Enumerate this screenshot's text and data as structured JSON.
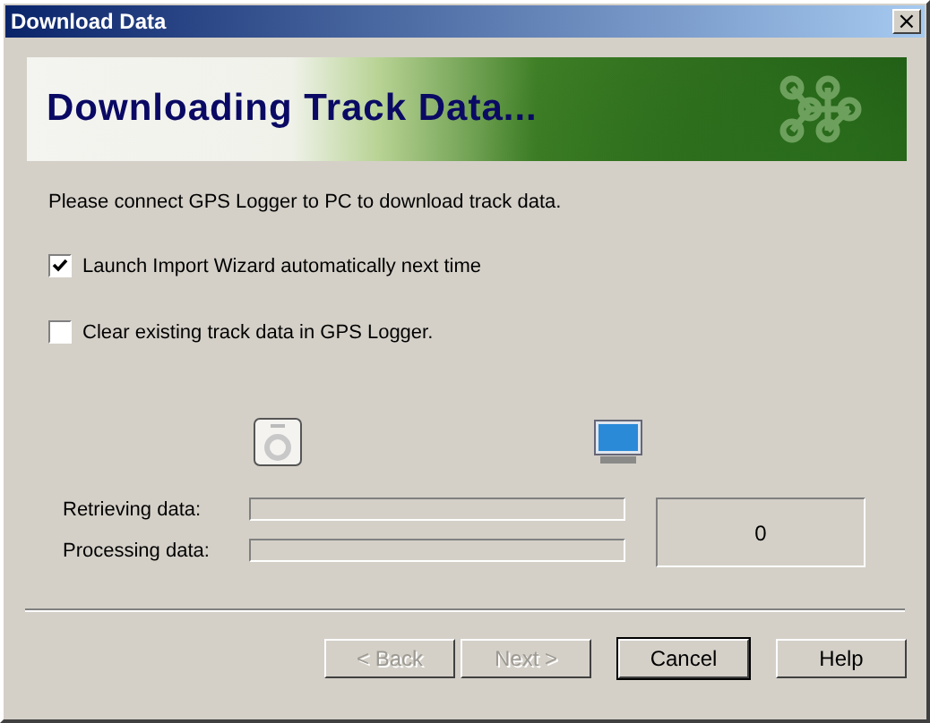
{
  "window": {
    "title": "Download Data",
    "close": "×"
  },
  "banner": {
    "title": "Downloading Track Data..."
  },
  "instruction": "Please connect GPS Logger to PC to download track data.",
  "options": [
    {
      "label": "Launch Import Wizard automatically next time",
      "checked": true
    },
    {
      "label": "Clear existing track data in GPS Logger.",
      "checked": false
    }
  ],
  "progress": [
    {
      "label": "Retrieving data:"
    },
    {
      "label": "Processing data:"
    }
  ],
  "count": "0",
  "buttons": [
    {
      "label": "< Back",
      "disabled": true,
      "default": false
    },
    {
      "label": "Next >",
      "disabled": true,
      "default": false
    },
    {
      "label": "Cancel",
      "disabled": false,
      "default": true
    },
    {
      "label": "Help",
      "disabled": false,
      "default": false
    }
  ]
}
